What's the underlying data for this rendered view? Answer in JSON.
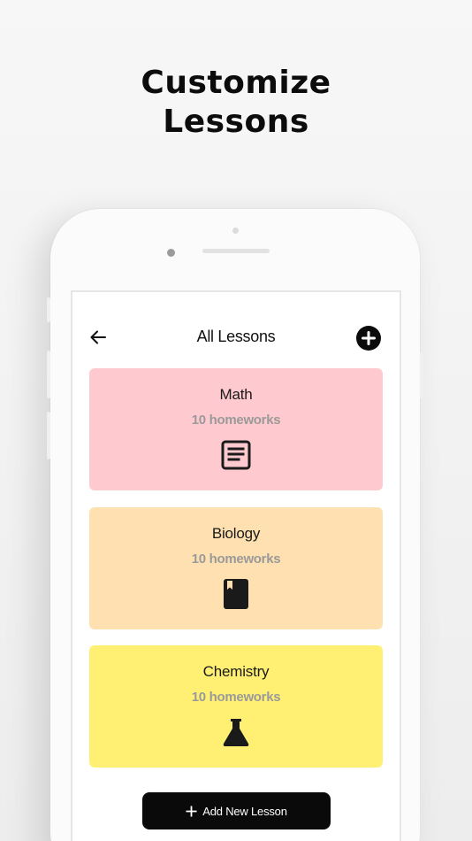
{
  "headline": {
    "line1": "Customize",
    "line2": "Lessons"
  },
  "header": {
    "title": "All Lessons",
    "back_icon": "arrow-left-icon",
    "add_icon": "plus-circle-icon"
  },
  "lessons": [
    {
      "name": "Math",
      "count": "10 homeworks",
      "icon": "document-lines-icon",
      "color": "#ffcacf"
    },
    {
      "name": "Biology",
      "count": "10 homeworks",
      "icon": "bookmark-book-icon",
      "color": "#fee0b1"
    },
    {
      "name": "Chemistry",
      "count": "10 homeworks",
      "icon": "flask-icon",
      "color": "#fff073"
    }
  ],
  "footer": {
    "add_lesson_label": "Add New Lesson"
  },
  "colors": {
    "primary": "#0a0a0a",
    "muted_text": "#9a9a9a"
  }
}
